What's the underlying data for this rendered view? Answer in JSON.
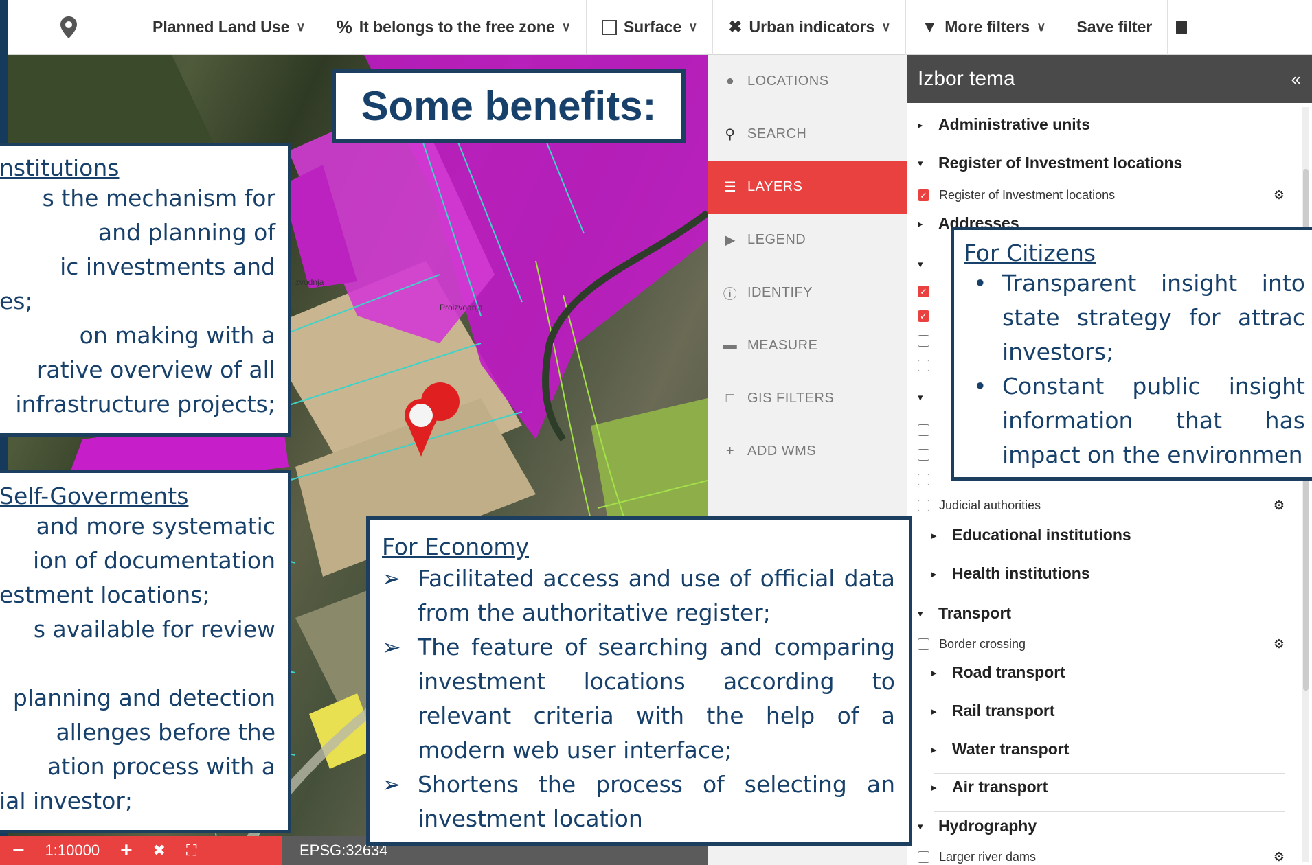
{
  "toolbar": {
    "items": [
      {
        "label": "Planned Land Use",
        "icon": "chevron-down-icon"
      },
      {
        "label": "It belongs to the free zone",
        "icon": "percent-icon"
      },
      {
        "label": "Surface",
        "icon": "area-icon"
      },
      {
        "label": "Urban indicators",
        "icon": "tools-icon"
      },
      {
        "label": "More filters",
        "icon": "filter-icon"
      }
    ],
    "save_label": "Save filter"
  },
  "nav": {
    "items": [
      "LOCATIONS",
      "SEARCH",
      "LAYERS",
      "LEGEND",
      "IDENTIFY",
      "MEASURE",
      "GIS FILTERS",
      "ADD WMS"
    ]
  },
  "panel": {
    "title": "Izbor tema",
    "collapse": "«",
    "groups": {
      "admin": "Administrative units",
      "register": "Register of Investment locations",
      "register_layer": "Register of Investment locations",
      "addresses": "Addresses",
      "judicial": "Judicial authorities",
      "educational": "Educational institutions",
      "health": "Health institutions",
      "transport": "Transport",
      "border": "Border crossing",
      "road": "Road transport",
      "rail": "Rail transport",
      "water": "Water transport",
      "air": "Air transport",
      "hydro": "Hydrography",
      "dams": "Larger river dams"
    }
  },
  "title": "Some benefits:",
  "institutions": {
    "heading": "nstitutions",
    "lines": [
      "s the mechanism for",
      "and planning of",
      "ic investments and",
      "es;",
      "on making with a",
      "rative overview of all",
      "infrastructure projects;"
    ]
  },
  "selfgov": {
    "heading": "Self-Goverments",
    "lines": [
      "and more systematic",
      "ion of documentation",
      "estment locations;",
      "s available for review",
      "",
      "planning and detection",
      "allenges before the",
      "ation process with a",
      "ial investor;"
    ]
  },
  "economy": {
    "heading": "For Economy",
    "items": [
      "Facilitated access and use of official data from the authoritative register;",
      "The feature of searching and comparing investment locations according to relevant criteria with the help of a modern web user interface;",
      "Shortens the process of selecting an investment location"
    ]
  },
  "citizens": {
    "heading": "For Citizens",
    "items": [
      "Transparent insight into state strategy for attrac investors;",
      "Constant public insight information that has impact on the environmen"
    ]
  },
  "mapbar": {
    "minus": "−",
    "scale": "1:10000",
    "plus": "+",
    "epsg": "EPSG:32634"
  },
  "map_labels": {
    "a": "zvodnja",
    "b": "Proizvodnja"
  }
}
